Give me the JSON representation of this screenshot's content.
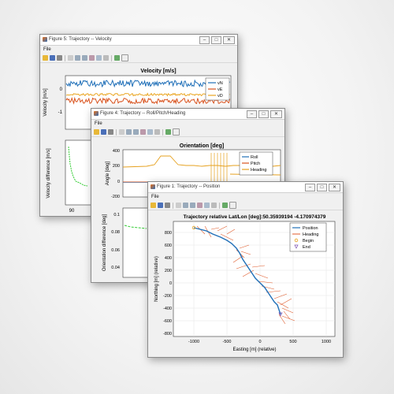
{
  "windows": {
    "velocity": {
      "title": "Figure 5: Trajectory -- Velocity",
      "menu": "File",
      "plot_title": "Velocity [m/s]",
      "ylabel": "Velocity [m/s]",
      "legend": [
        "vN",
        "vE",
        "vD"
      ],
      "yticks": [
        "0",
        "-1"
      ],
      "sub_ylabel": "Velocity difference [m/s]",
      "sub_xtick": "90",
      "sub_xtick2": "90",
      "series_colors": [
        "#1f6fb8",
        "#d9531e",
        "#eaa521"
      ]
    },
    "orientation": {
      "title": "Figure 4: Trajectory -- Roll/Pitch/Heading",
      "menu": "File",
      "plot_title": "Orientation [deg]",
      "ylabel": "Angle [deg]",
      "yticks": [
        "400",
        "200",
        "0",
        "-200"
      ],
      "legend": [
        "Roll",
        "Pitch",
        "Heading"
      ],
      "sub_ylabel": "Orientation difference [deg]",
      "sub_yticks": [
        "0.1",
        "0.08",
        "0.06",
        "0.04"
      ],
      "sub_xtick": "90"
    },
    "position": {
      "title": "Figure 1: Trajectory -- Position",
      "menu": "File",
      "plot_title": "Trajectory relative Lat/Lon [deg]:50.35939194    -4.170974379",
      "ylabel": "Northing [m] (relative)",
      "xlabel": "Easting [m] (relative)",
      "yticks": [
        "800",
        "600",
        "400",
        "200",
        "0",
        "-200",
        "-400",
        "-600",
        "-800"
      ],
      "xticks": [
        "-1000",
        "-500",
        "0",
        "500",
        "1000"
      ],
      "legend": [
        "Position",
        "Heading",
        "Begin",
        "End"
      ]
    }
  },
  "window_buttons": {
    "minimize": "–",
    "maximize": "□",
    "close": "✕"
  },
  "icons": [
    "open-folder-icon",
    "save-icon",
    "print-icon",
    "pointer-icon",
    "zoom-in-icon",
    "zoom-out-icon",
    "pan-icon",
    "rotate-icon",
    "datacursor-icon",
    "brush-icon",
    "colorbar-icon",
    "legend-icon"
  ],
  "colors": {
    "position": "#1f6fb8",
    "heading": "#e05a2a",
    "begin": "#e6a11f",
    "end": "#7a4fb0",
    "diff": "#33cc33"
  }
}
